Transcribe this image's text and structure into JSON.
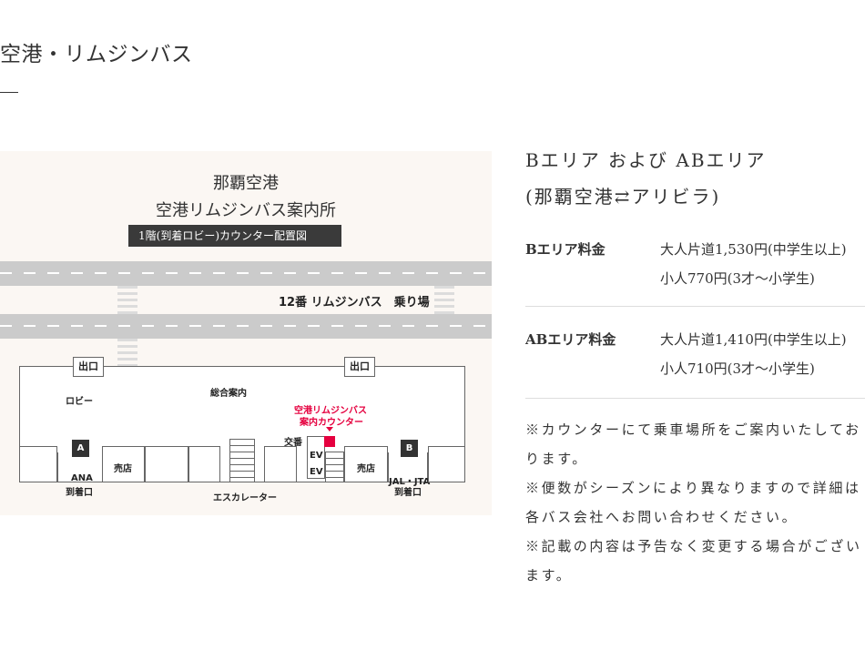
{
  "page": {
    "title": "空港・リムジンバス"
  },
  "map": {
    "title_line1": "那覇空港",
    "title_line2": "空港リムジンバス案内所",
    "banner": "1階(到着ロビー)カウンター配置図",
    "stop_label": "12番 リムジンバス　乗り場",
    "exit_left": "出口",
    "exit_right": "出口",
    "lobby": "ロビー",
    "info_center": "総合案内",
    "counter_line1": "空港リムジンバス",
    "counter_line2": "案内カウンター",
    "police_box": "交番",
    "ev1": "EV",
    "ev2": "EV",
    "shop_left": "売店",
    "shop_right": "売店",
    "marker_a": "A",
    "marker_b": "B",
    "ana_line1": "ANA",
    "ana_line2": "到着口",
    "jal_line1": "JAL・JTA",
    "jal_line2": "到着口",
    "escalator": "エスカレーター",
    "accent_color": "#e5003f"
  },
  "fare": {
    "title_line1": "Bエリア および ABエリア",
    "title_line2": "(那覇空港⇄アリビラ)",
    "rows": [
      {
        "label": "Bエリア料金",
        "adult": "大人片道1,530円(中学生以上)",
        "child": "小人770円(3才〜小学生)"
      },
      {
        "label": "ABエリア料金",
        "adult": "大人片道1,410円(中学生以上)",
        "child": "小人710円(3才〜小学生)"
      }
    ]
  },
  "notes": [
    "※カウンターにて乗車場所をご案内いたしております。",
    "※便数がシーズンにより異なりますので詳細は各バス会社へお問い合わせください。",
    "※記載の内容は予告なく変更する場合がございます。"
  ]
}
